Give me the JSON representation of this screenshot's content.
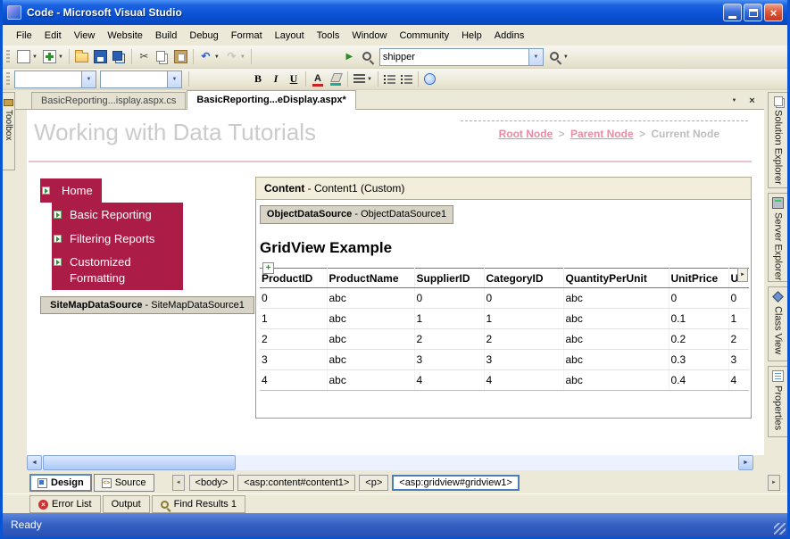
{
  "window": {
    "title": "Code - Microsoft Visual Studio",
    "status": "Ready"
  },
  "menu_items": [
    "File",
    "Edit",
    "View",
    "Website",
    "Build",
    "Debug",
    "Format",
    "Layout",
    "Tools",
    "Window",
    "Community",
    "Help",
    "Addins"
  ],
  "toolbar": {
    "search_combo_value": "shipper"
  },
  "doc_tabs": [
    {
      "label": "BasicReporting...isplay.aspx.cs"
    },
    {
      "label": "BasicReporting...eDisplay.aspx*"
    }
  ],
  "side_tabs": {
    "left": "Toolbox",
    "right": [
      "Solution Explorer",
      "Server Explorer",
      "Class View",
      "Properties"
    ]
  },
  "design": {
    "page_title": "Working with Data Tutorials",
    "breadcrumb": {
      "root": "Root Node",
      "sep1": ">",
      "parent": "Parent Node",
      "sep2": ">",
      "current": "Current Node"
    },
    "nav_items": [
      "Home",
      "Basic Reporting",
      "Filtering Reports",
      "Customized Formatting"
    ],
    "sitemapdatasource": {
      "bold": "SiteMapDataSource",
      "rest": " - SiteMapDataSource1"
    },
    "content_header": {
      "bold": "Content",
      "rest": " - Content1 (Custom)"
    },
    "objectdatasource": {
      "bold": "ObjectDataSource",
      "rest": " - ObjectDataSource1"
    },
    "gridview_title": "GridView Example",
    "grid": {
      "headers": [
        "ProductID",
        "ProductName",
        "SupplierID",
        "CategoryID",
        "QuantityPerUnit",
        "UnitPrice",
        "Uni"
      ],
      "rows": [
        [
          "0",
          "abc",
          "0",
          "0",
          "abc",
          "0",
          "0"
        ],
        [
          "1",
          "abc",
          "1",
          "1",
          "abc",
          "0.1",
          "1"
        ],
        [
          "2",
          "abc",
          "2",
          "2",
          "abc",
          "0.2",
          "2"
        ],
        [
          "3",
          "abc",
          "3",
          "3",
          "abc",
          "0.3",
          "3"
        ],
        [
          "4",
          "abc",
          "4",
          "4",
          "abc",
          "0.4",
          "4"
        ]
      ]
    }
  },
  "view_bar": {
    "design_label": "Design",
    "source_label": "Source",
    "source_icon_text": "<>",
    "tags": [
      "<body>",
      "<asp:content#content1>",
      "<p>",
      "<asp:gridview#gridview1>"
    ]
  },
  "bottom_tabs": [
    "Error List",
    "Output",
    "Find Results 1"
  ],
  "colors": {
    "nav_background": "#AB1D46",
    "breadcrumb_link": "#E98CA4",
    "titlebar_blue": "#0B53D6",
    "chrome_tan": "#ECE9D8"
  },
  "icons": {
    "window_close": "×",
    "tab_menu": "▼",
    "tab_close": "×",
    "combo_arrow": "▼",
    "dropdown_arrow": "▼",
    "cut": "✂",
    "undo": "↶",
    "redo": "↷",
    "play": "▶",
    "bold": "B",
    "italic": "I",
    "underline": "U",
    "font_color": "A",
    "scroll_left": "◄",
    "scroll_right": "►",
    "tag_nav_left": "◄",
    "tag_nav_right": "►",
    "smart_tag": "►",
    "move_handle": "+",
    "error_badge": "×"
  }
}
